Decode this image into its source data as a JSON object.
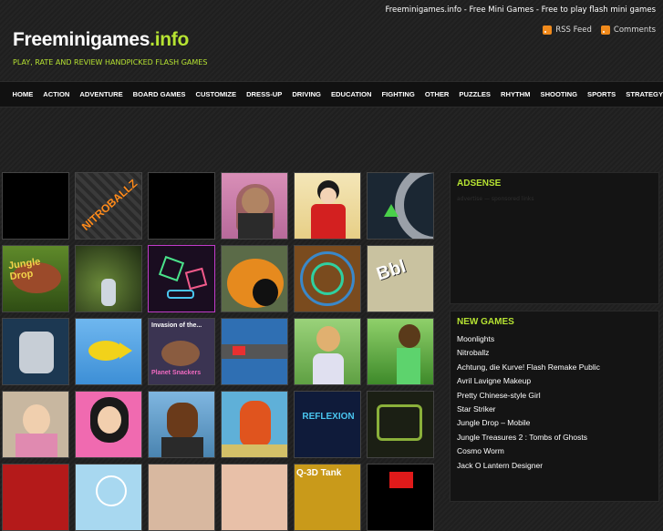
{
  "header": {
    "top_text": "Freeminigames.info - Free Mini Games - Free to play flash mini games",
    "feeds": {
      "rss": "RSS Feed",
      "comments": "Comments"
    },
    "logo_main": "Freeminigames",
    "logo_ext": ".info",
    "tagline": "PLAY, RATE AND REVIEW HANDPICKED FLASH GAMES"
  },
  "nav": [
    "HOME",
    "ACTION",
    "ADVENTURE",
    "BOARD GAMES",
    "CUSTOMIZE",
    "DRESS-UP",
    "DRIVING",
    "EDUCATION",
    "FIGHTING",
    "OTHER",
    "PUZZLES",
    "RHYTHM",
    "SHOOTING",
    "SPORTS",
    "STRATEGY"
  ],
  "thumb_labels": {
    "nitroballz": "NITROBALLZ",
    "invasion": "Invasion of the...",
    "planet": "Planet Snackers",
    "reflexion": "REFLEXION",
    "q3d": "Q-3D Tank"
  },
  "sidebar": {
    "adsense_title": "ADSENSE",
    "adsense_hint": "advertise — sponsored links",
    "newgames_title": "NEW GAMES",
    "newgames": [
      "Moonlights",
      "Nitroballz",
      "Achtung, die Kurve! Flash Remake Public",
      "Avril Lavigne Makeup",
      "Pretty Chinese-style Girl",
      "Star Striker",
      "Jungle Drop – Mobile",
      "Jungle Treasures 2 : Tombs of Ghosts",
      "Cosmo Worm",
      "Jack O Lantern Designer"
    ]
  },
  "colors": {
    "accent": "#b6e332",
    "nav_bg": "#111111",
    "rss": "#f08a1c"
  }
}
